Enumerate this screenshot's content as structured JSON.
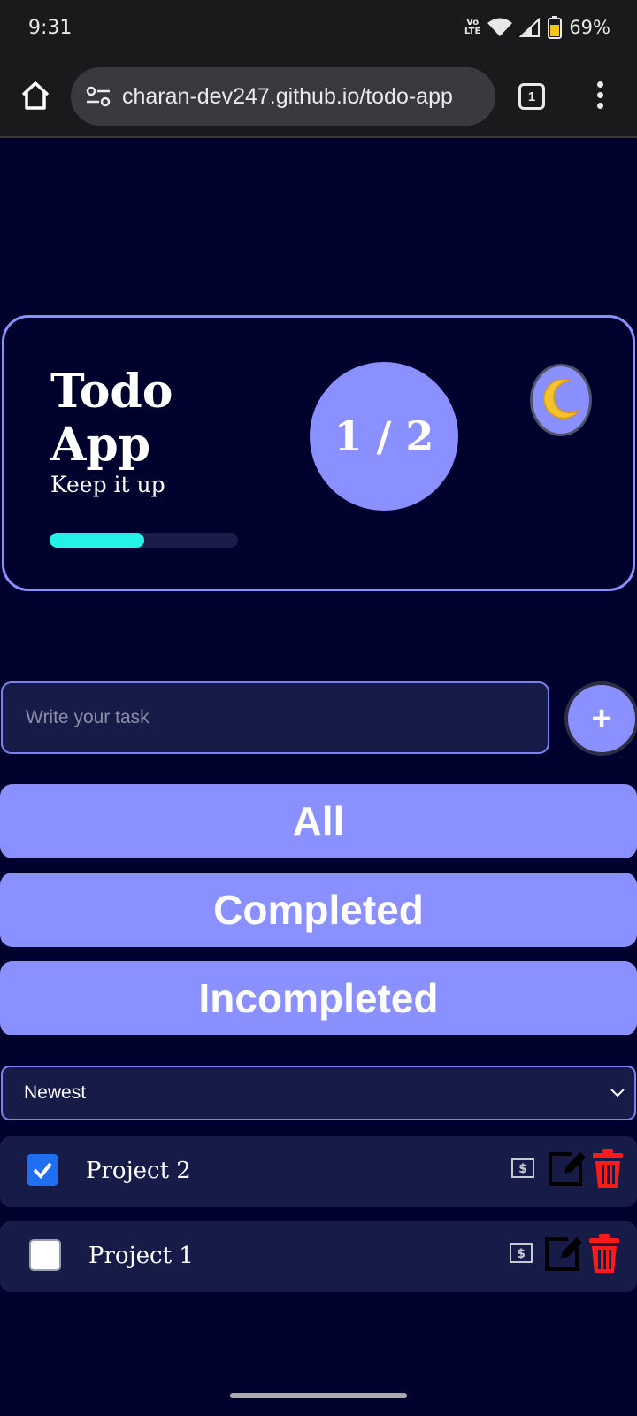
{
  "status_bar": {
    "time": "9:31",
    "network": "VoLTE",
    "network_top": "Vo",
    "network_bottom": "LTE",
    "battery": "69%"
  },
  "browser": {
    "url": "charan-dev247.github.io/todo-app",
    "tab_count": "1",
    "icons": [
      "home-icon",
      "site-settings-icon",
      "tabs-icon",
      "overflow-menu-icon"
    ]
  },
  "hero": {
    "title": "Todo App",
    "subtitle": "Keep it up",
    "count": "1 / 2",
    "progress": 0.5,
    "theme_icon": "moon-icon"
  },
  "input": {
    "placeholder": "Write your task",
    "add_label": "+"
  },
  "filters": [
    {
      "label": "All"
    },
    {
      "label": "Completed"
    },
    {
      "label": "Incompleted"
    }
  ],
  "sort": {
    "selected": "Newest"
  },
  "todos": [
    {
      "label": "Project 2",
      "completed": true
    },
    {
      "label": "Project 1",
      "completed": false
    }
  ],
  "colors": {
    "background": "#00022e",
    "accent": "#8a90ff",
    "progress": "#22f3e6",
    "delete": "#ff1a1a",
    "checkbox_checked": "#1f6ff0",
    "panel": "#171b48"
  }
}
